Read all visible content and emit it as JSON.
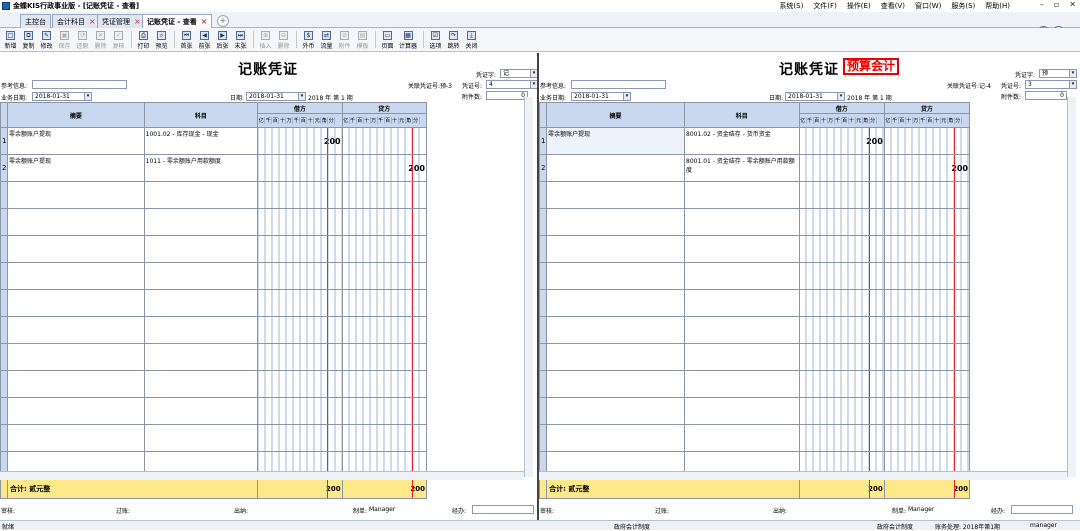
{
  "app": {
    "title": "金蝶KIS行政事业版 - [记账凭证 - 查看]"
  },
  "menu": [
    "系统(S)",
    "文件(F)",
    "操作(E)",
    "查看(V)",
    "窗口(W)",
    "服务(S)",
    "帮助(H)"
  ],
  "tabs": [
    {
      "label": "主控台",
      "closable": false
    },
    {
      "label": "会计科目",
      "closable": true
    },
    {
      "label": "凭证管理",
      "closable": true
    },
    {
      "label": "记账凭证 - 查看",
      "closable": true,
      "active": true
    }
  ],
  "toolbar": [
    {
      "label": "新增",
      "icon": "new-icon",
      "enabled": true
    },
    {
      "label": "复制",
      "icon": "copy-icon",
      "enabled": true
    },
    {
      "label": "修改",
      "icon": "edit-icon",
      "enabled": true
    },
    {
      "label": "保存",
      "icon": "save-icon",
      "enabled": false
    },
    {
      "label": "还原",
      "icon": "restore-icon",
      "enabled": false
    },
    {
      "label": "删除",
      "icon": "delete-icon",
      "enabled": false
    },
    {
      "label": "复核",
      "icon": "review-icon",
      "enabled": false
    },
    {
      "label": "打印",
      "icon": "print-icon",
      "enabled": true
    },
    {
      "label": "预览",
      "icon": "preview-icon",
      "enabled": true
    },
    {
      "label": "首张",
      "icon": "first-icon",
      "enabled": true
    },
    {
      "label": "前张",
      "icon": "prev-icon",
      "enabled": true
    },
    {
      "label": "后张",
      "icon": "next-icon",
      "enabled": true
    },
    {
      "label": "末张",
      "icon": "last-icon",
      "enabled": true
    },
    {
      "label": "插入",
      "icon": "insert-icon",
      "enabled": false
    },
    {
      "label": "删除",
      "icon": "remove-icon",
      "enabled": false
    },
    {
      "label": "外币",
      "icon": "currency-icon",
      "enabled": true
    },
    {
      "label": "流量",
      "icon": "flow-icon",
      "enabled": true
    },
    {
      "label": "附件",
      "icon": "attach-icon",
      "enabled": false
    },
    {
      "label": "模板",
      "icon": "template-icon",
      "enabled": false
    },
    {
      "label": "页面",
      "icon": "page-icon",
      "enabled": true
    },
    {
      "label": "计算器",
      "icon": "calculator-icon",
      "enabled": true
    },
    {
      "label": "选项",
      "icon": "options-icon",
      "enabled": true
    },
    {
      "label": "跳转",
      "icon": "jump-icon",
      "enabled": true
    },
    {
      "label": "关闭",
      "icon": "close-icon",
      "enabled": true
    }
  ],
  "labels": {
    "ref": "参考信息:",
    "biz_date": "业务日期:",
    "date": "日期:",
    "voucher_word": "凭证字:",
    "voucher_no": "凭证号:",
    "attachments": "附件数:",
    "summary_col": "摘要",
    "account_col": "科目",
    "debit_col": "借方",
    "credit_col": "贷方",
    "digit_units": "亿千百十万千百十元角分",
    "audit": "审核:",
    "post": "过账:",
    "cashier": "出纳:",
    "maker": "制单:",
    "handler": "经办:"
  },
  "left": {
    "title": "记账凭证",
    "biz_date": "2018-01-31",
    "date": "2018-01-31",
    "period_text": "2018 年 第 1 期",
    "linked_voucher": "关联凭证号:预-3",
    "voucher_word": "记",
    "voucher_no": "4",
    "attachments": "0",
    "rows": [
      {
        "idx": "1",
        "summary": "零余额账户提现",
        "account": "1001.02 - 库存现金 - 现金",
        "debit": "200",
        "credit": ""
      },
      {
        "idx": "2",
        "summary": "零余额账户提现",
        "account": "1011 - 零余额账户用款额度",
        "debit": "",
        "credit": "200"
      }
    ],
    "total_label": "合计: 贰元整",
    "total_debit": "200",
    "total_credit": "200",
    "maker": "Manager"
  },
  "right": {
    "title": "记账凭证",
    "badge": "预算会计",
    "biz_date": "2018-01-31",
    "date": "2018-01-31",
    "period_text": "2018 年 第 1 期",
    "linked_voucher": "关联凭证号:记-4",
    "voucher_word": "预",
    "voucher_no": "3",
    "attachments": "0",
    "rows": [
      {
        "idx": "1",
        "summary": "零余额账户提现",
        "account": "8001.02 - 资金结存 - 货币资金",
        "debit": "200",
        "credit": ""
      },
      {
        "idx": "2",
        "summary": "",
        "account": "8001.01 - 资金结存 - 零余额账户用款额度",
        "debit": "",
        "credit": "200"
      }
    ],
    "total_label": "合计: 贰元整",
    "total_debit": "200",
    "total_credit": "200",
    "maker": "Manager"
  },
  "status": {
    "ready": "就绪",
    "system1": "政府会计制度",
    "system2": "政府会计制度",
    "period": "账务处理: 2018年第1期",
    "user": "manager"
  }
}
